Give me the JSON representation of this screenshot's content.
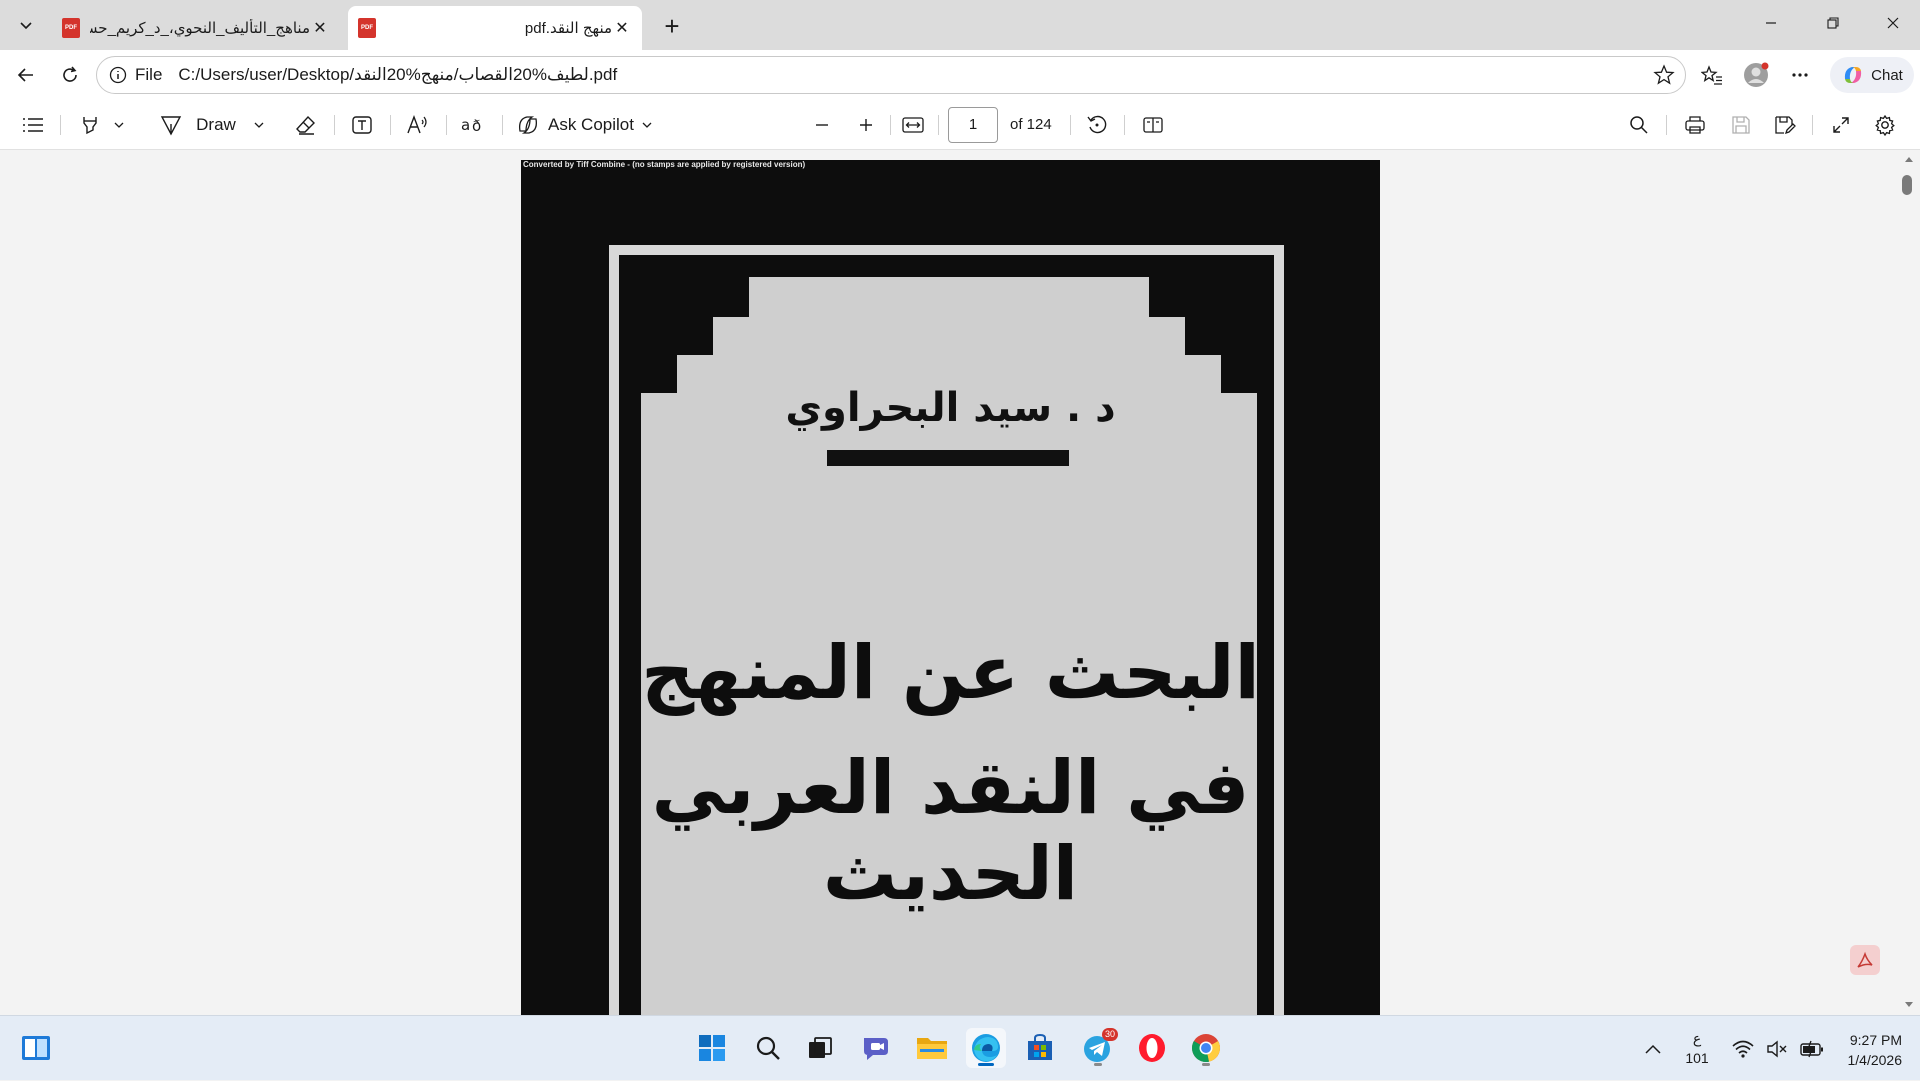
{
  "browser": {
    "tabs": [
      {
        "title": "مناهج_التأليف_النحوي،_د_كريم_حسين",
        "active": false
      },
      {
        "title": "منهج النقد.pdf",
        "active": true
      }
    ],
    "address": {
      "scheme_label": "File",
      "url": "C:/Users/user/Desktop/لطيف%20القصاب/منهج%20النقد.pdf"
    },
    "chat_label": "Chat"
  },
  "pdf_toolbar": {
    "draw_label": "Draw",
    "ask_copilot_label": "Ask Copilot",
    "current_page": "1",
    "page_count_label": "of 124"
  },
  "document": {
    "converted_note": "Converted by Tiff Combine - (no stamps are applied by registered version)",
    "author": "د . سيد البحراوي",
    "title_line_1": "البحث عن المنهج",
    "title_line_2": "في النقد العربي الحديث"
  },
  "taskbar": {
    "apps": [
      "start",
      "search",
      "task-view",
      "teams",
      "file-explorer",
      "edge",
      "store",
      "telegram",
      "opera",
      "chrome"
    ],
    "telegram_badge": "30",
    "input_lang_1": "ع",
    "input_lang_2": "101",
    "time": "9:27 PM",
    "date": "1/4/2026"
  },
  "colors": {
    "pdf_red": "#d4342c",
    "accent_blue": "#0067c0",
    "taskbar_bg": "#e4ecf6"
  }
}
